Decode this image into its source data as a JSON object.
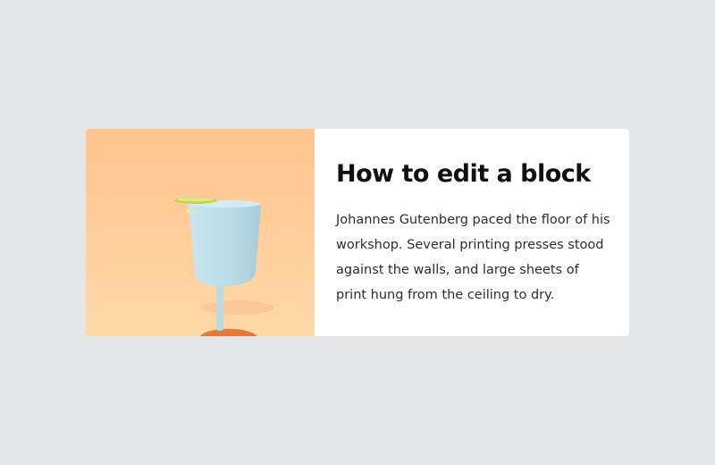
{
  "block": {
    "title": "How to edit a block",
    "body": "Johannes Gutenberg paced the floor of his workshop. Several printing presses stood against the walls, and large sheets of print hung from the ceiling to dry."
  },
  "image": {
    "subject": "cocktail-glass-image",
    "colors": {
      "background_top": "#ffc692",
      "background_bottom": "#ffd7a6",
      "glass": "#bfe0ea",
      "glass_shadow": "#a4cad8",
      "lime": "#c9d64f",
      "sand": "#e47a36"
    }
  }
}
